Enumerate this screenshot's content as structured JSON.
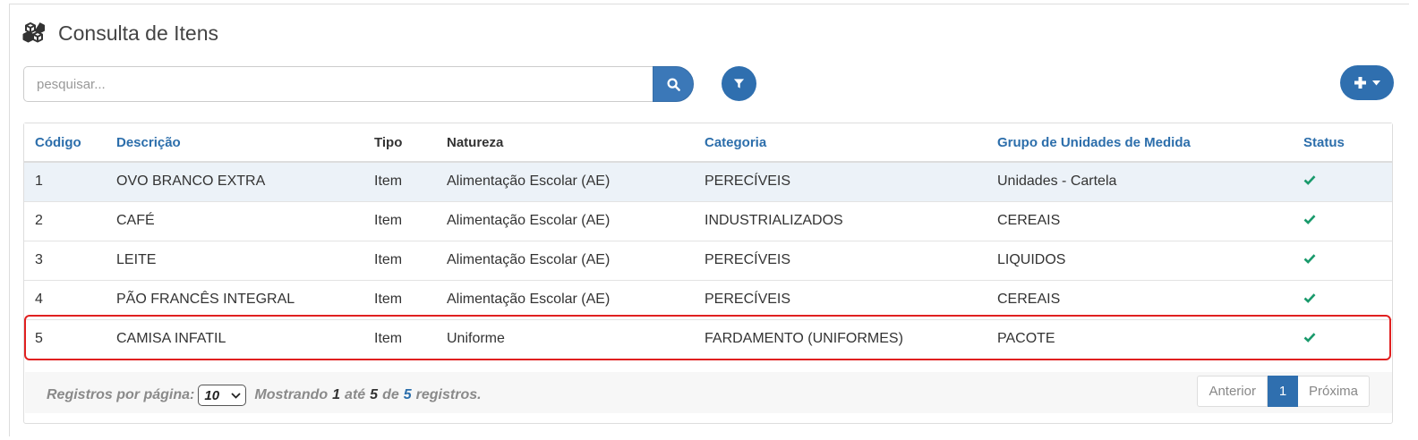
{
  "header": {
    "title": "Consulta de Itens",
    "icon": "cubes-icon"
  },
  "search": {
    "placeholder": "pesquisar...",
    "value": "",
    "button_icon": "search-icon"
  },
  "toolbar": {
    "filter_icon": "filter-icon",
    "add_icon": "plus-icon",
    "add_caret_icon": "caret-down-icon"
  },
  "table": {
    "columns": [
      "Código",
      "Descrição",
      "Tipo",
      "Natureza",
      "Categoria",
      "Grupo de Unidades de Medida",
      "Status"
    ],
    "rows": [
      {
        "codigo": "1",
        "descricao": "OVO BRANCO EXTRA",
        "tipo": "Item",
        "natureza": "Alimentação Escolar (AE)",
        "categoria": "PERECÍVEIS",
        "grupo": "Unidades - Cartela",
        "status": "active"
      },
      {
        "codigo": "2",
        "descricao": "CAFÉ",
        "tipo": "Item",
        "natureza": "Alimentação Escolar (AE)",
        "categoria": "INDUSTRIALIZADOS",
        "grupo": "CEREAIS",
        "status": "active"
      },
      {
        "codigo": "3",
        "descricao": "LEITE",
        "tipo": "Item",
        "natureza": "Alimentação Escolar (AE)",
        "categoria": "PERECÍVEIS",
        "grupo": "LIQUIDOS",
        "status": "active"
      },
      {
        "codigo": "4",
        "descricao": "PÃO FRANCÊS INTEGRAL",
        "tipo": "Item",
        "natureza": "Alimentação Escolar (AE)",
        "categoria": "PERECÍVEIS",
        "grupo": "CEREAIS",
        "status": "active"
      },
      {
        "codigo": "5",
        "descricao": "CAMISA INFATIL",
        "tipo": "Item",
        "natureza": "Uniforme",
        "categoria": "FARDAMENTO (UNIFORMES)",
        "grupo": "PACOTE",
        "status": "active"
      }
    ]
  },
  "footer": {
    "per_page_label": "Registros por página:",
    "per_page_value": "10",
    "showing_label": "Mostrando",
    "from": "1",
    "to_label": "até",
    "to": "5",
    "of_label": "de",
    "total": "5",
    "records_label": "registros."
  },
  "pagination": {
    "prev_label": "Anterior",
    "current_page": "1",
    "next_label": "Próxima"
  },
  "colors": {
    "primary": "#2f6faf",
    "link": "#2c6eab",
    "success": "#1a9a6c",
    "highlight": "#e02020"
  }
}
